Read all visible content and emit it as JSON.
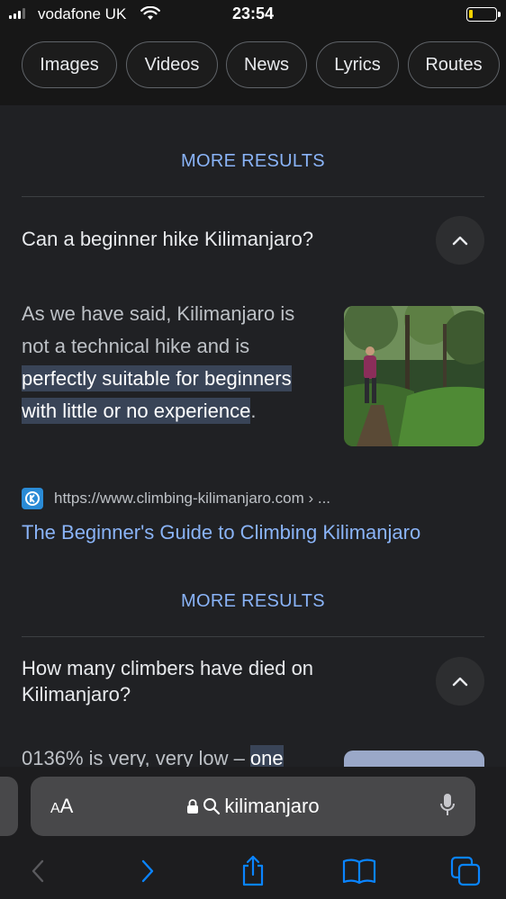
{
  "status": {
    "carrier": "vodafone UK",
    "time": "23:54"
  },
  "chips": [
    "Images",
    "Videos",
    "News",
    "Lyrics",
    "Routes"
  ],
  "more_results_label": "MORE RESULTS",
  "faq": [
    {
      "question": "Can a beginner hike Kilimanjaro?",
      "answer_plain": "As we have said, Kilimanjaro is not a technical hike and is ",
      "answer_line2": "not a technical hike and is",
      "answer_highlight": "perfectly suitable for beginners with little or no experience",
      "answer_end": ".",
      "source_url": "https://www.climbing-kilimanjaro.com › ...",
      "result_title": "The Beginner's Guide to Climbing Kilimanjaro"
    },
    {
      "question": "How many climbers have died on Kilimanjaro?",
      "answer_plain": "0136% is very, very low – ",
      "answer_highlight": "one"
    }
  ],
  "browser": {
    "aa_label": "AA",
    "address": "kilimanjaro"
  },
  "colors": {
    "background": "#202124",
    "link": "#8ab4f8",
    "highlight": "#394457"
  }
}
